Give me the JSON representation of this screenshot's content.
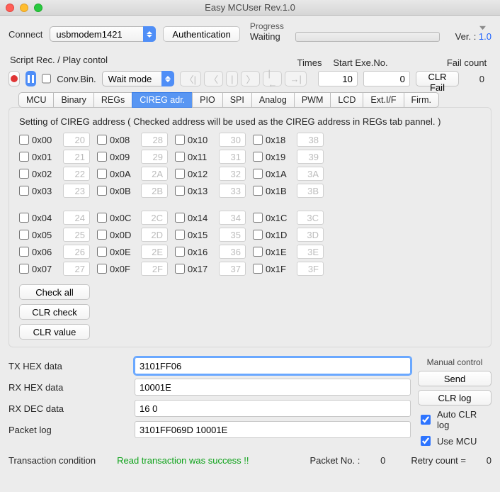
{
  "window": {
    "title": "Easy MCUser Rev.1.0"
  },
  "connect": {
    "label": "Connect",
    "device": "usbmodem1421",
    "auth_label": "Authentication"
  },
  "progress": {
    "title": "Progress",
    "status": "Waiting"
  },
  "version": {
    "prefix": "Ver. : ",
    "value": "1.0"
  },
  "script": {
    "label": "Script Rec. / Play contol",
    "times_h": "Times",
    "start_h": "Start Exe.No.",
    "fail_h": "Fail count",
    "conv_label": "Conv.Bin.",
    "waitmode": "Wait mode",
    "times": "10",
    "start": "0",
    "clr_fail": "CLR Fail",
    "fail_count": "0"
  },
  "tabs": [
    "MCU",
    "Binary",
    "REGs",
    "CIREG adr.",
    "PIO",
    "SPI",
    "Analog",
    "PWM",
    "LCD",
    "Ext.I/F",
    "Firm."
  ],
  "active_tab": 3,
  "panel": {
    "title": "Setting of CIREG address ( Checked address will be used as the CIREG address in REGs tab pannel. )",
    "check_all": "Check all",
    "clr_check": "CLR check",
    "clr_value": "CLR value",
    "cols": [
      [
        {
          "addr": "0x00",
          "val": "20"
        },
        {
          "addr": "0x01",
          "val": "21"
        },
        {
          "addr": "0x02",
          "val": "22"
        },
        {
          "addr": "0x03",
          "val": "23"
        },
        {
          "gap": true
        },
        {
          "addr": "0x04",
          "val": "24"
        },
        {
          "addr": "0x05",
          "val": "25"
        },
        {
          "addr": "0x06",
          "val": "26"
        },
        {
          "addr": "0x07",
          "val": "27"
        }
      ],
      [
        {
          "addr": "0x08",
          "val": "28"
        },
        {
          "addr": "0x09",
          "val": "29"
        },
        {
          "addr": "0x0A",
          "val": "2A"
        },
        {
          "addr": "0x0B",
          "val": "2B"
        },
        {
          "gap": true
        },
        {
          "addr": "0x0C",
          "val": "2C"
        },
        {
          "addr": "0x0D",
          "val": "2D"
        },
        {
          "addr": "0x0E",
          "val": "2E"
        },
        {
          "addr": "0x0F",
          "val": "2F"
        }
      ],
      [
        {
          "addr": "0x10",
          "val": "30"
        },
        {
          "addr": "0x11",
          "val": "31"
        },
        {
          "addr": "0x12",
          "val": "32"
        },
        {
          "addr": "0x13",
          "val": "33"
        },
        {
          "gap": true
        },
        {
          "addr": "0x14",
          "val": "34"
        },
        {
          "addr": "0x15",
          "val": "35"
        },
        {
          "addr": "0x16",
          "val": "36"
        },
        {
          "addr": "0x17",
          "val": "37"
        }
      ],
      [
        {
          "addr": "0x18",
          "val": "38"
        },
        {
          "addr": "0x19",
          "val": "39"
        },
        {
          "addr": "0x1A",
          "val": "3A"
        },
        {
          "addr": "0x1B",
          "val": "3B"
        },
        {
          "gap": true
        },
        {
          "addr": "0x1C",
          "val": "3C"
        },
        {
          "addr": "0x1D",
          "val": "3D"
        },
        {
          "addr": "0x1E",
          "val": "3E"
        },
        {
          "addr": "0x1F",
          "val": "3F"
        }
      ]
    ]
  },
  "tx": {
    "label": "TX HEX data",
    "value": "3101FF06"
  },
  "rxh": {
    "label": "RX HEX data",
    "value": "10001E"
  },
  "rxd": {
    "label": "RX DEC data",
    "value": "16 0"
  },
  "plog": {
    "label": "Packet log",
    "value": "3101FF069D 10001E"
  },
  "manual": {
    "title": "Manual control",
    "send": "Send",
    "clr": "CLR log",
    "auto": "Auto CLR log",
    "use": "Use MCU"
  },
  "status": {
    "cond_label": "Transaction condition",
    "cond_value": "Read transaction was success !!",
    "packet_label": "Packet No. :",
    "packet_value": "0",
    "retry_label": "Retry count  =",
    "retry_value": "0"
  }
}
